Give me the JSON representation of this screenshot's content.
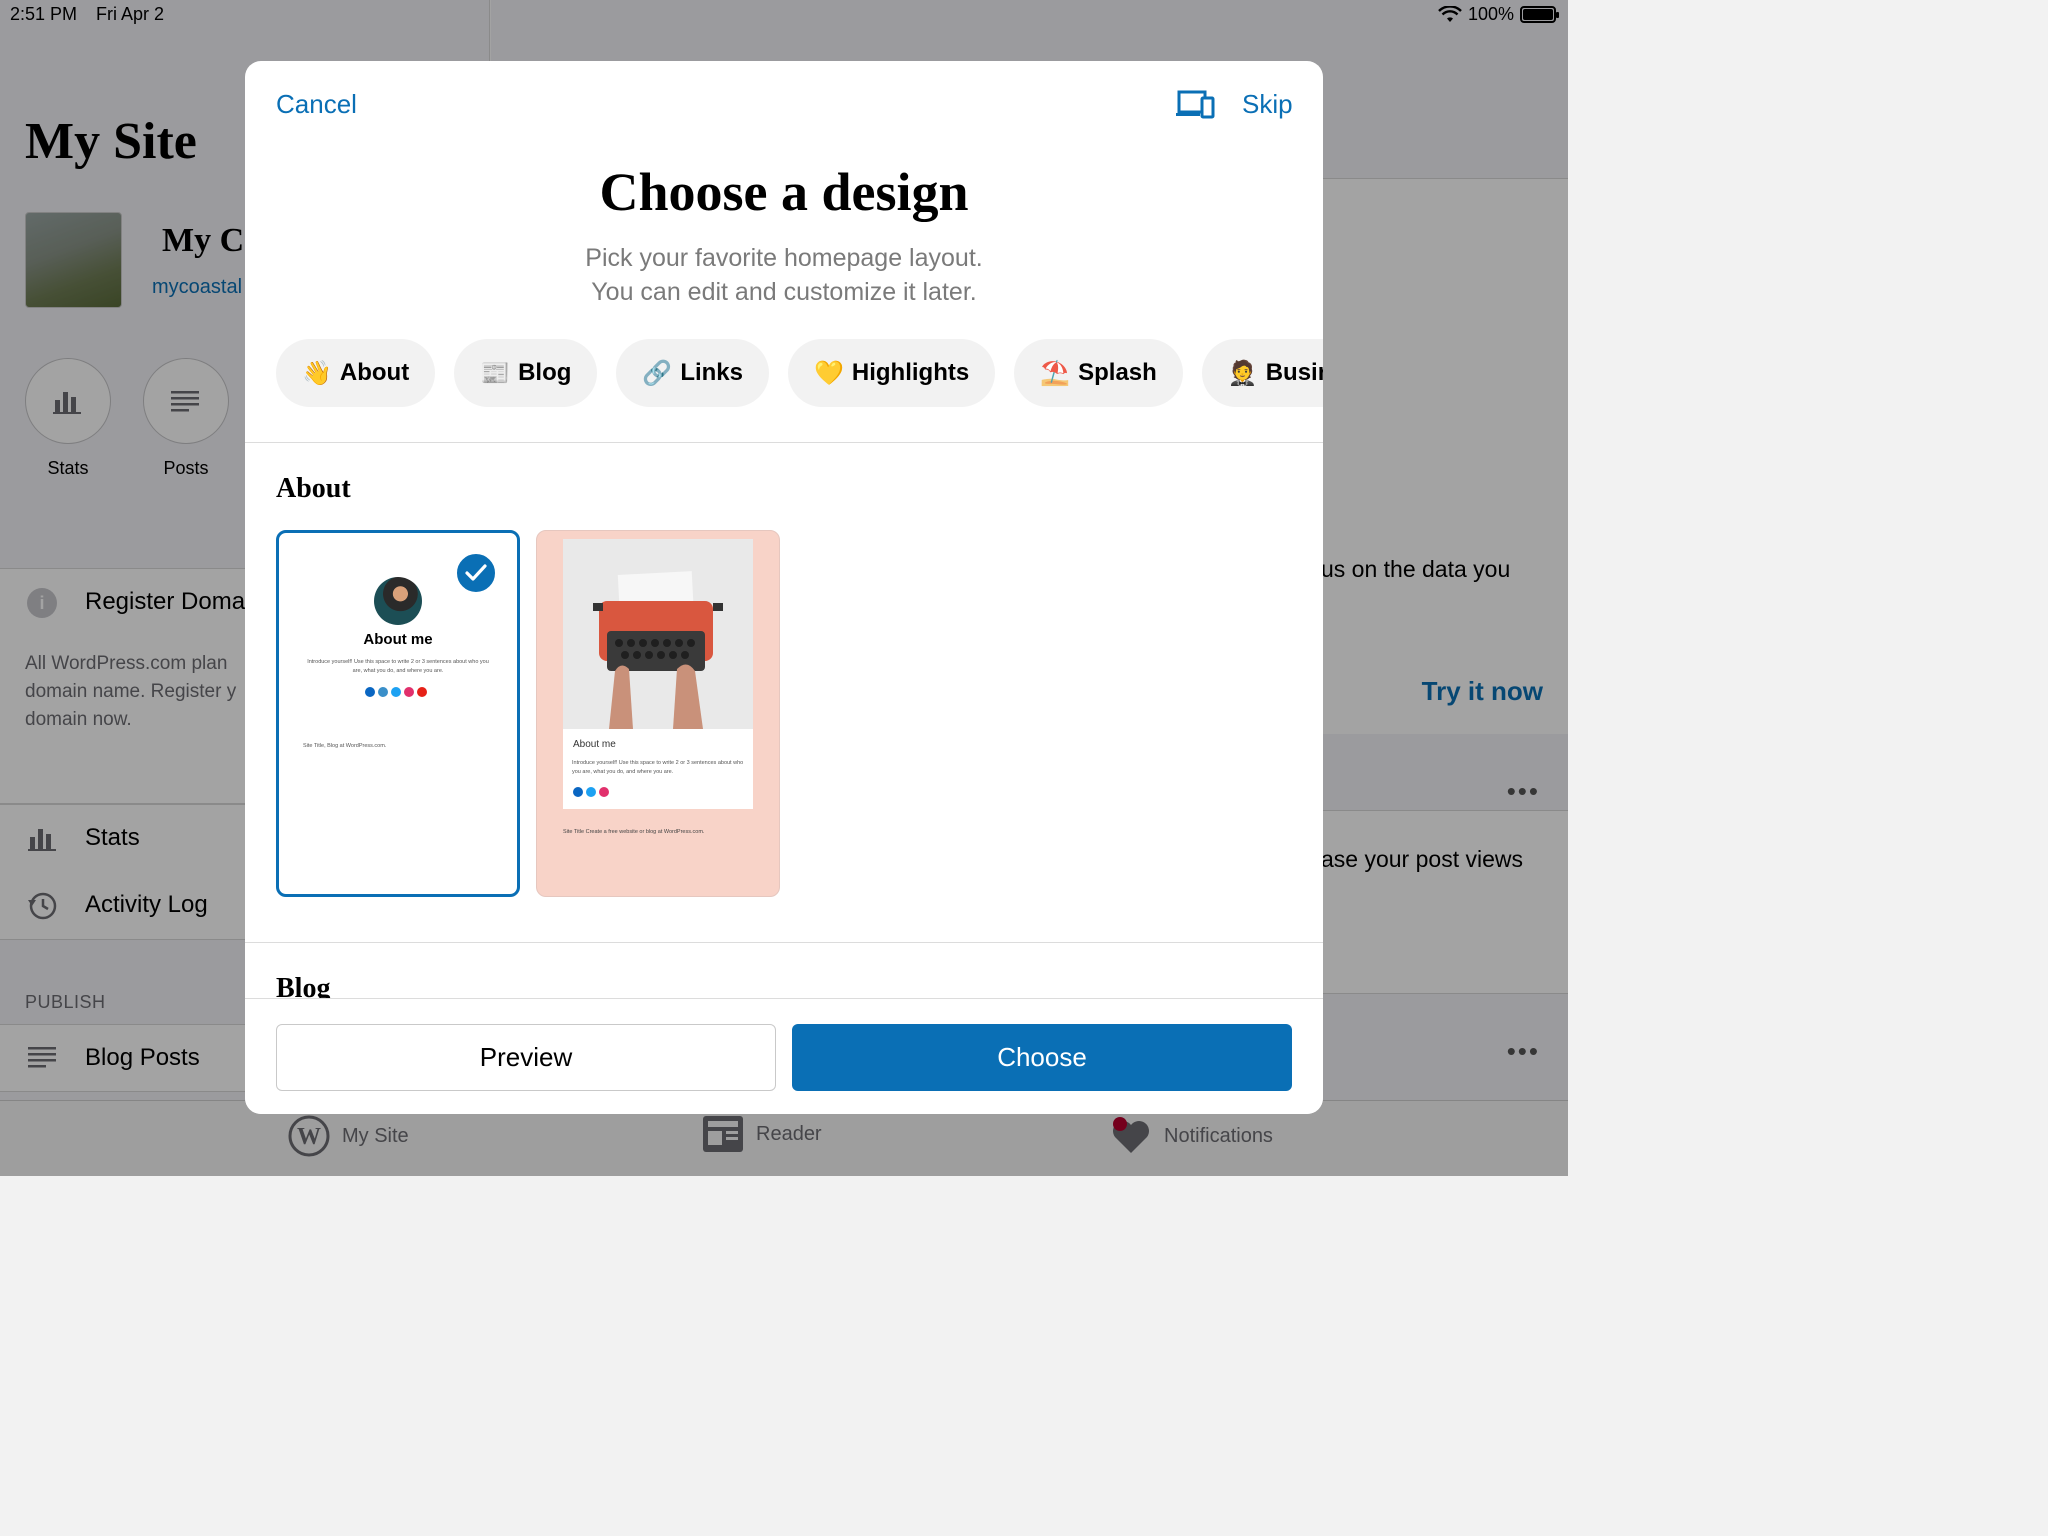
{
  "status_bar": {
    "time": "2:51 PM",
    "date": "Fri Apr 2",
    "battery": "100%"
  },
  "background": {
    "page_title": "My Site",
    "site_name": "My Co",
    "site_url": "mycoastal",
    "quick_actions": [
      "Stats",
      "Posts"
    ],
    "register_domain": "Register Doma",
    "domain_desc": "All WordPress.com plan domain name. Register y domain now.",
    "menu_stats": "Stats",
    "menu_activity": "Activity Log",
    "publish_header": "PUBLISH",
    "menu_blog_posts": "Blog Posts",
    "right_text_1": "us on the data you",
    "try_now": "Try it now",
    "right_text_2": "ase your post views",
    "more": "•••"
  },
  "tab_bar": {
    "my_site": "My Site",
    "reader": "Reader",
    "notifications": "Notifications"
  },
  "modal": {
    "cancel": "Cancel",
    "skip": "Skip",
    "title": "Choose a design",
    "subtitle_line1": "Pick your favorite homepage layout.",
    "subtitle_line2": "You can edit and customize it later.",
    "categories": [
      {
        "emoji": "👋",
        "label": "About"
      },
      {
        "emoji": "📰",
        "label": "Blog"
      },
      {
        "emoji": "🔗",
        "label": "Links"
      },
      {
        "emoji": "💛",
        "label": "Highlights"
      },
      {
        "emoji": "⛱️",
        "label": "Splash"
      },
      {
        "emoji": "🤵",
        "label": "Business"
      }
    ],
    "section_about": "About",
    "section_blog": "Blog",
    "card1": {
      "heading": "About me",
      "intro": "Introduce yourself! Use this space to write 2 or 3 sentences about who you are, what you do, and where you are.",
      "footer": "Site Title, Blog at WordPress.com."
    },
    "card2": {
      "heading": "About me",
      "intro": "Introduce yourself! Use this space to write 2 or 3 sentences about who you are, what you do, and where you are.",
      "footer": "Site Title  Create a free website or blog at WordPress.com."
    },
    "preview": "Preview",
    "choose": "Choose"
  },
  "colors": {
    "accent": "#0a6fb5",
    "card_pink": "#f8d3c8"
  }
}
